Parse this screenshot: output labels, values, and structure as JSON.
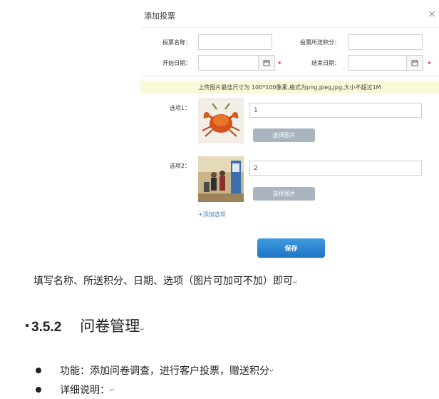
{
  "dialog": {
    "title": "添加投票",
    "close": "×",
    "fields": {
      "vote_name_label": "投票名称：",
      "points_label": "投票所送积分：",
      "start_label": "开始日期：",
      "end_label": "结束日期：",
      "required_mark": "•"
    },
    "notice": "上传图片最佳尺寸为 100*100像素,格式为png,jpeg,jpg,大小不超过1M",
    "options": [
      {
        "label": "选项1：",
        "value": "1",
        "button": "选择图片"
      },
      {
        "label": "选项2：",
        "value": "2",
        "button": "选择图片"
      }
    ],
    "add_option": "+添加选项",
    "save": "保存"
  },
  "doc": {
    "paragraph": "填写名称、所送积分、日期、选项（图片可加可不加）即可",
    "section_number": "3.5.2",
    "section_title": "问卷管理",
    "bullets": [
      "功能：添加问卷调查，进行客户投票，赠送积分",
      "详细说明："
    ],
    "return_mark": "↵"
  }
}
